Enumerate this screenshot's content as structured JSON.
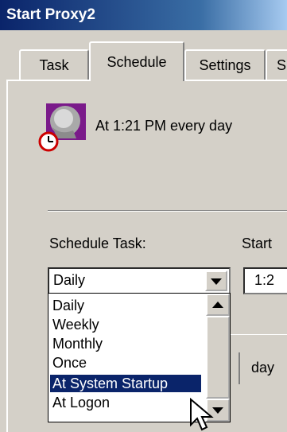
{
  "window": {
    "title": "Start Proxy2"
  },
  "tabs": [
    {
      "label": "Task",
      "active": false
    },
    {
      "label": "Schedule",
      "active": true
    },
    {
      "label": "Settings",
      "active": false
    },
    {
      "label": "S",
      "active": false
    }
  ],
  "summary": {
    "text": "At 1:21 PM every day"
  },
  "schedule_task": {
    "label": "Schedule Task:",
    "value": "Daily",
    "options": [
      "Daily",
      "Weekly",
      "Monthly",
      "Once",
      "At System Startup",
      "At Logon"
    ],
    "highlighted": "At System Startup"
  },
  "start_time": {
    "label": "Start",
    "value": "1:2"
  },
  "day_label": "day",
  "colors": {
    "title_bar": "#0a246a",
    "selection": "#0a246a",
    "face": "#d4d0c8"
  },
  "icons": [
    "scheduled-task-icon",
    "clock-icon",
    "dropdown-arrow-icon",
    "scroll-up-icon",
    "scroll-down-icon",
    "mouse-cursor-icon"
  ]
}
